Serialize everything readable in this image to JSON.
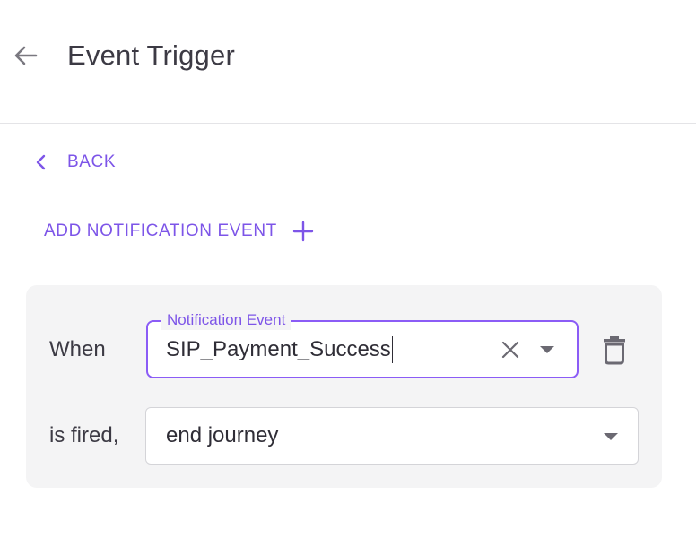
{
  "header": {
    "title": "Event Trigger",
    "back_icon": "arrow-left-icon"
  },
  "nav": {
    "back_label": "BACK",
    "back_icon": "chevron-left-icon"
  },
  "actions": {
    "add_event_label": "ADD NOTIFICATION EVENT",
    "add_icon": "plus-icon"
  },
  "rule": {
    "when_label": "When",
    "event_field": {
      "label": "Notification Event",
      "value": "SIP_Payment_Success",
      "clear_icon": "close-icon",
      "dropdown_icon": "caret-down-icon"
    },
    "delete_icon": "trash-icon",
    "fired_label": "is fired,",
    "action_field": {
      "value": "end journey",
      "dropdown_icon": "caret-down-icon"
    }
  },
  "colors": {
    "accent": "#7d55e8",
    "focus_border": "#8b5cf6",
    "card_background": "#f4f4f5",
    "text": "#3c3a44"
  }
}
